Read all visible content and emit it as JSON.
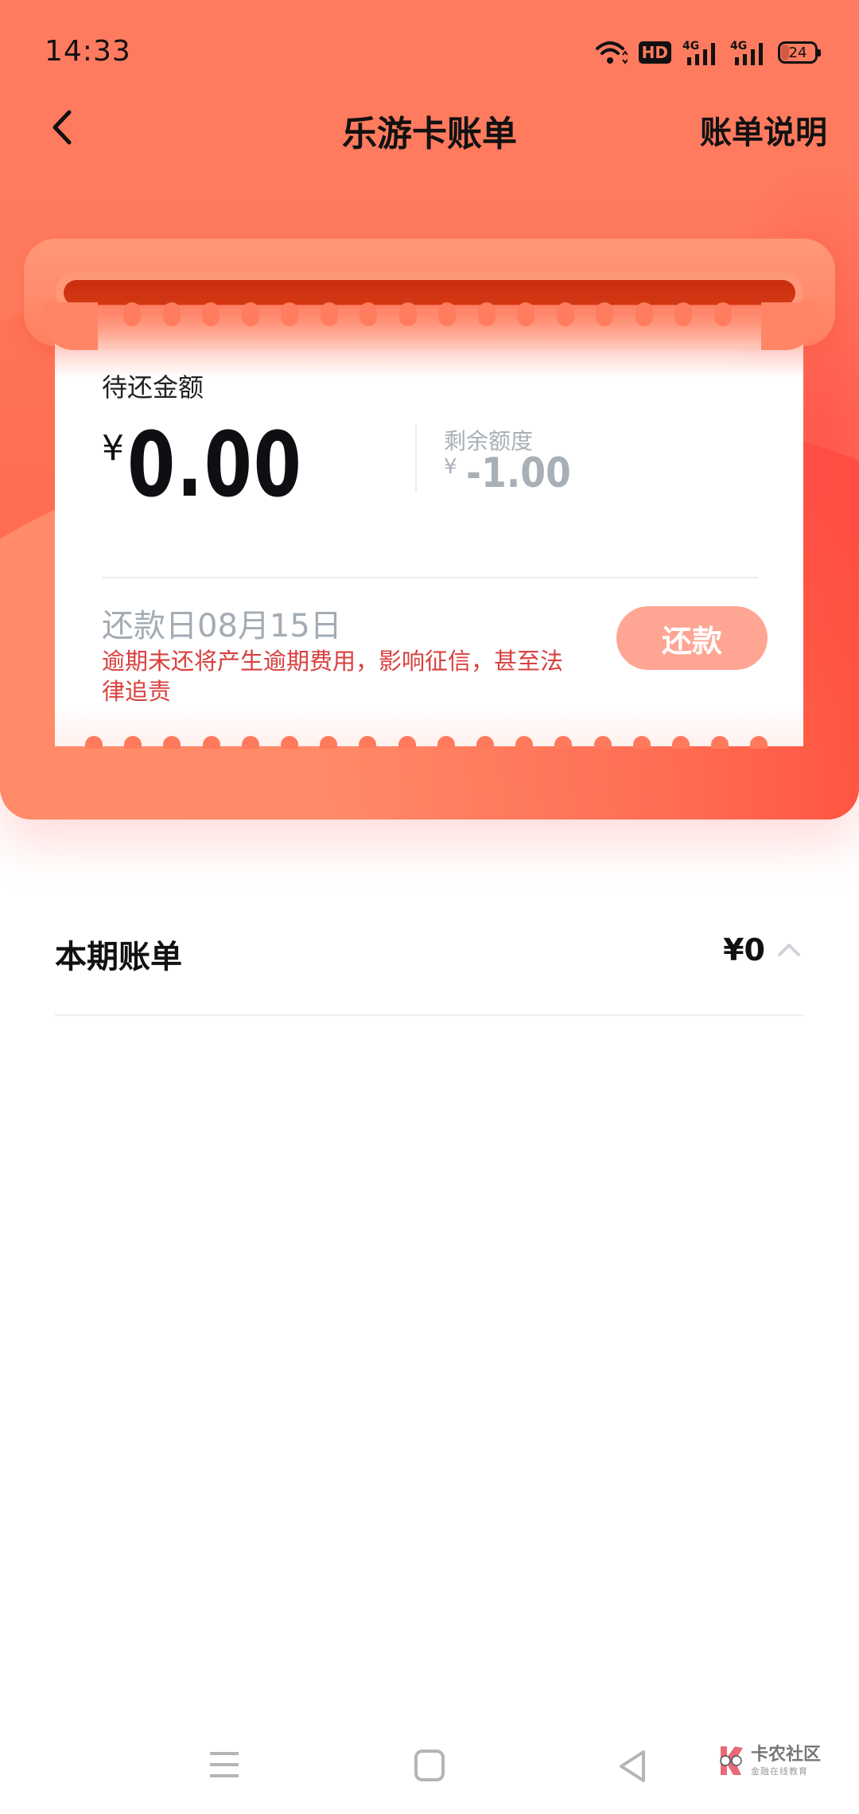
{
  "status_bar": {
    "time": "14:33",
    "icons": [
      "wifi-icon",
      "hd-voice-icon",
      "signal-4g-icon",
      "signal-4g-icon",
      "battery-icon"
    ],
    "hd_label": "HD",
    "network_label": "4G",
    "battery_level": "24"
  },
  "nav": {
    "back_icon": "chevron-left-icon",
    "title": "乐游卡账单",
    "right_link": "账单说明"
  },
  "bill_card": {
    "due_label": "待还金额",
    "currency_symbol": "¥",
    "due_amount": "0.00",
    "credit_label": "剩余额度",
    "credit_amount": "-1.00",
    "due_date": "还款日08月15日",
    "warning": "逾期未还将产生逾期费用，影响征信，甚至法律追责",
    "repay_button": "还款"
  },
  "current_bill": {
    "title": "本期账单",
    "amount": "¥0",
    "toggle_icon": "chevron-up-icon"
  },
  "system_nav": {
    "buttons": [
      "menu-icon",
      "home-icon",
      "back-icon"
    ]
  },
  "watermark": {
    "main": "卡农社区",
    "sub": "金融在线教育"
  },
  "colors": {
    "header_bg": "#FF7B60",
    "slot_dark": "#C82E10",
    "repay_button": "#FFA593",
    "warning_text": "#D8403E",
    "muted_text": "#A9AFB6"
  }
}
